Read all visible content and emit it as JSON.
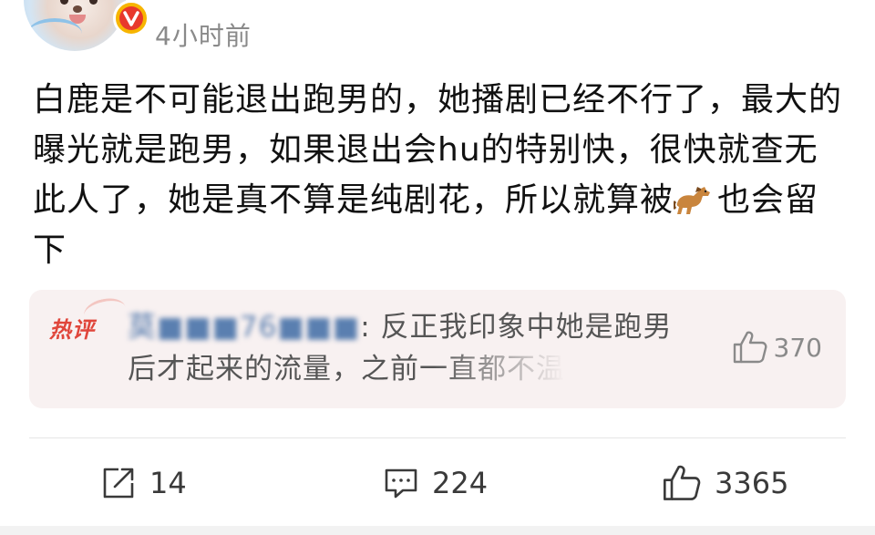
{
  "header": {
    "timestamp": "4小时前",
    "verified_badge": "V"
  },
  "post": {
    "text": "白鹿是不可能退出跑男的，她播剧已经不行了，最大的曝光就是跑男，如果退出会hu的特别快，很快就查无此人了，她是真不算是纯剧花，所以就算被",
    "emoji": "horse-emoji",
    "text_after_emoji": "也会留下"
  },
  "hot_comment": {
    "tag": "热评",
    "user": "莫■■■76■■■",
    "separator": ":",
    "text_line1": " 反正我印象中她是跑男",
    "text_line2": "后才起来的流量，之前一直都不温",
    "likes": "370"
  },
  "actions": {
    "repost_count": "14",
    "comment_count": "224",
    "like_count": "3365"
  },
  "colors": {
    "hot_tag": "#e0463b",
    "hot_comment_bg": "#f8f1f1",
    "timestamp": "#8a8a8a",
    "verified": "#f7b500"
  }
}
